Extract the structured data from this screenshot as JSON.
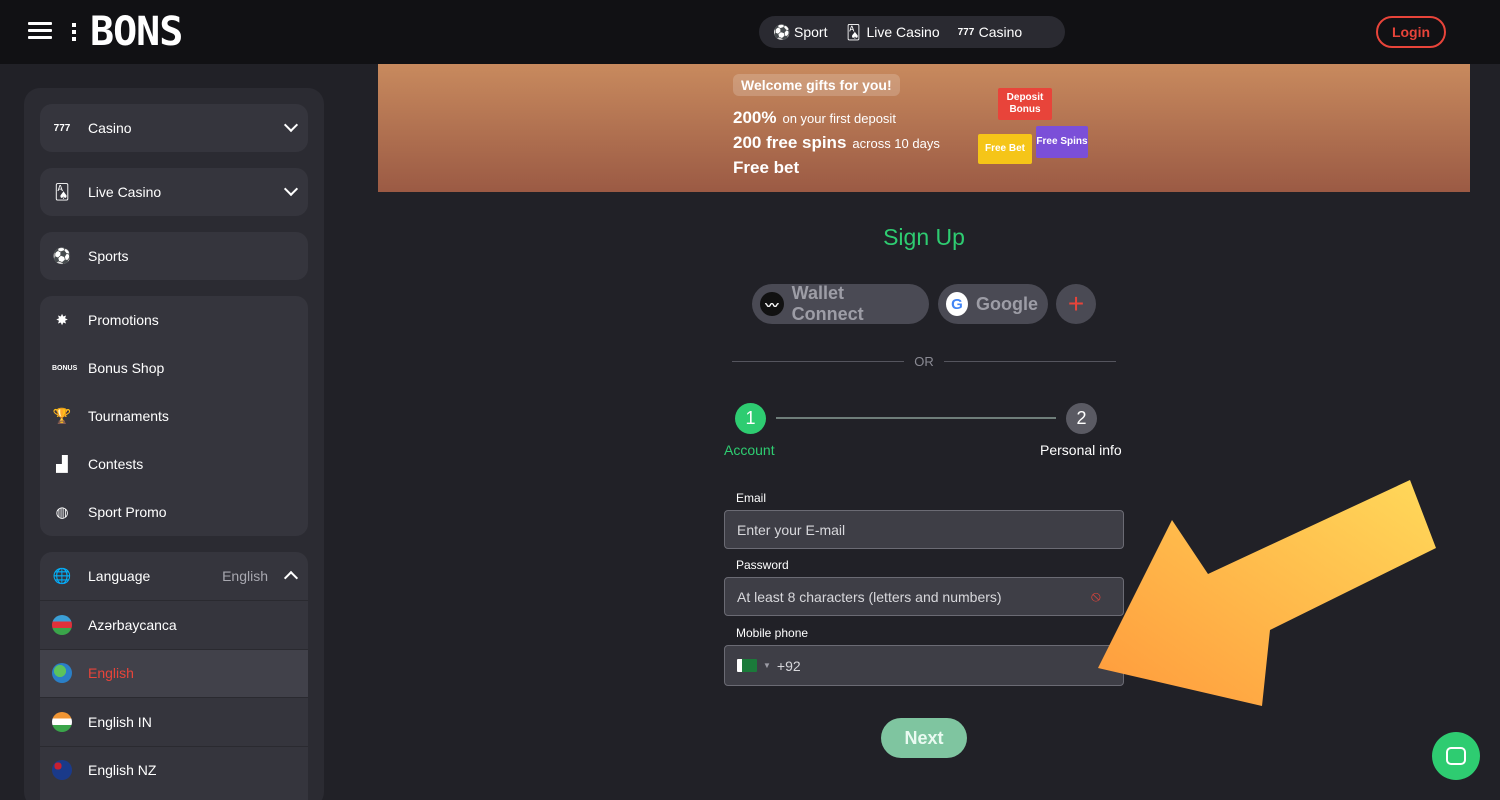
{
  "header": {
    "logo": "BONS",
    "nav": [
      {
        "label": "Sport",
        "icon": "soccer-ball-icon"
      },
      {
        "label": "Live Casino",
        "icon": "cards-icon"
      },
      {
        "label": "Casino",
        "icon": "slot-777-icon"
      }
    ],
    "login_label": "Login"
  },
  "sidebar": {
    "casino": "Casino",
    "live_casino": "Live Casino",
    "sports": "Sports",
    "promo_items": [
      "Promotions",
      "Bonus Shop",
      "Tournaments",
      "Contests",
      "Sport Promo"
    ],
    "language_label": "Language",
    "language_value": "English",
    "languages": [
      "Azərbaycanca",
      "English",
      "English IN",
      "English NZ"
    ],
    "active_language": "English"
  },
  "banner": {
    "welcome": "Welcome gifts for you!",
    "line1_big": "200%",
    "line1_small": "on your first deposit",
    "line2_big": "200 free spins",
    "line2_small": "across 10 days",
    "line3_big": "Free bet",
    "tag_deposit": "Deposit Bonus",
    "tag_freebet": "Free Bet",
    "tag_spins": "Free Spins"
  },
  "signup": {
    "title": "Sign Up",
    "wallet_connect": "Wallet Connect",
    "google": "Google",
    "or": "OR",
    "step1_num": "1",
    "step1_label": "Account",
    "step2_num": "2",
    "step2_label": "Personal info",
    "email_label": "Email",
    "email_placeholder": "Enter your E-mail",
    "password_label": "Password",
    "password_placeholder": "At least 8 characters (letters and numbers)",
    "phone_label": "Mobile phone",
    "phone_code": "+92",
    "next_label": "Next"
  },
  "colors": {
    "accent_red": "#e8443a",
    "accent_green": "#2ecc71"
  }
}
